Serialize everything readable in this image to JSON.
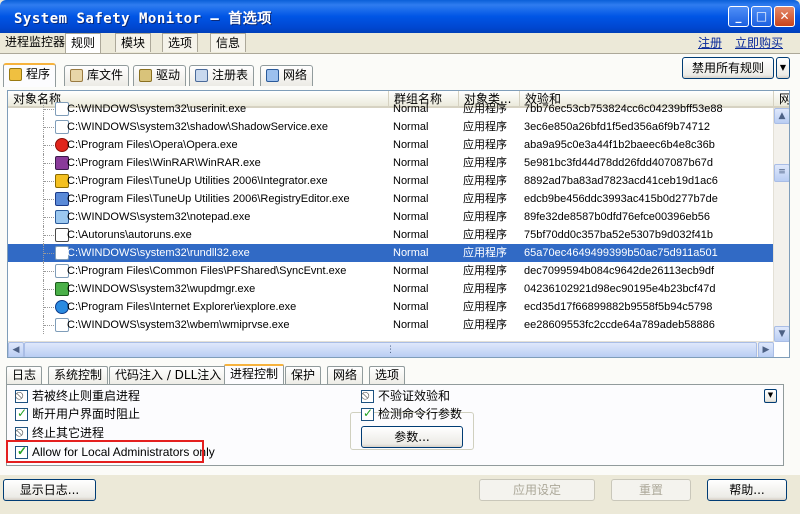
{
  "window": {
    "title": "System Safety Monitor — 首选项"
  },
  "titlebar_buttons": {
    "minimize": "_",
    "maximize": "□",
    "close": "✕"
  },
  "menu_tabs": [
    "进程监控器",
    "规则",
    "模块",
    "选项",
    "信息"
  ],
  "menu_links": {
    "register": "注册",
    "buy": "立即购买"
  },
  "sub_tabs": [
    "程序",
    "库文件",
    "驱动",
    "注册表",
    "网络"
  ],
  "disable_all_button": "禁用所有规则",
  "columns": [
    "对象名称",
    "群组名称",
    "对象类...",
    "效验和",
    "网"
  ],
  "rows": [
    {
      "path": "C:\\WINDOWS\\system32\\userinit.exe",
      "group": "Normal",
      "type": "应用程序",
      "checksum": "7bb76ec53cb753824cc6c04239bff53e88",
      "icon": "file-icon",
      "clip": true
    },
    {
      "path": "C:\\WINDOWS\\system32\\shadow\\ShadowService.exe",
      "group": "Normal",
      "type": "应用程序",
      "checksum": "3ec6e850a26bfd1f5ed356a6f9b74712",
      "icon": "file-icon"
    },
    {
      "path": "C:\\Program Files\\Opera\\Opera.exe",
      "group": "Normal",
      "type": "应用程序",
      "checksum": "aba9a95c0e3a44f1b2baeec6b4e8c36b",
      "icon": "opera-icon"
    },
    {
      "path": "C:\\Program Files\\WinRAR\\WinRAR.exe",
      "group": "Normal",
      "type": "应用程序",
      "checksum": "5e981bc3fd44d78dd26fdd407087b67d",
      "icon": "winrar-icon"
    },
    {
      "path": "C:\\Program Files\\TuneUp Utilities 2006\\Integrator.exe",
      "group": "Normal",
      "type": "应用程序",
      "checksum": "8892ad7ba83ad7823acd41ceb19d1ac6",
      "icon": "tuneup-icon"
    },
    {
      "path": "C:\\Program Files\\TuneUp Utilities 2006\\RegistryEditor.exe",
      "group": "Normal",
      "type": "应用程序",
      "checksum": "edcb9be456ddc3993ac415b0d277b7de",
      "icon": "registry-editor-icon"
    },
    {
      "path": "C:\\WINDOWS\\system32\\notepad.exe",
      "group": "Normal",
      "type": "应用程序",
      "checksum": "89fe32de8587b0dfd76efce00396eb56",
      "icon": "notepad-icon"
    },
    {
      "path": "C:\\Autoruns\\autoruns.exe",
      "group": "Normal",
      "type": "应用程序",
      "checksum": "75bf70dd0c357ba52e5307b9d032f41b",
      "icon": "autoruns-icon"
    },
    {
      "path": "C:\\WINDOWS\\system32\\rundll32.exe",
      "group": "Normal",
      "type": "应用程序",
      "checksum": "65a70ec4649499399b50ac75d911a501",
      "icon": "file-icon",
      "selected": true
    },
    {
      "path": "C:\\Program Files\\Common Files\\PFShared\\SyncEvnt.exe",
      "group": "Normal",
      "type": "应用程序",
      "checksum": "dec7099594b084c9642de26113ecb9df",
      "icon": "file-icon"
    },
    {
      "path": "C:\\WINDOWS\\system32\\wupdmgr.exe",
      "group": "Normal",
      "type": "应用程序",
      "checksum": "04236102921d98ec90195e4b23bcf47d",
      "icon": "windows-update-icon"
    },
    {
      "path": "C:\\Program Files\\Internet Explorer\\iexplore.exe",
      "group": "Normal",
      "type": "应用程序",
      "checksum": "ecd35d17f66899882b9558f5b94c5798",
      "icon": "ie-icon"
    },
    {
      "path": "C:\\WINDOWS\\system32\\wbem\\wmiprvse.exe",
      "group": "Normal",
      "type": "应用程序",
      "checksum": "ee28609553fc2ccde64a789adeb58886",
      "icon": "file-icon"
    }
  ],
  "lower_tabs": [
    "日志",
    "系统控制",
    "代码注入 / DLL注入",
    "进程控制",
    "保护",
    "网络",
    "选项"
  ],
  "options": {
    "restart_if_terminated": "若被终止则重启进程",
    "block_on_ui_disconnect": "断开用户界面时阻止",
    "terminate_other": "终止其它进程",
    "allow_local_admins": "Allow for Local Administrators only",
    "no_checksum": "不验证效验和",
    "check_cmdline": "检测命令行参数",
    "params_button": "参数..."
  },
  "bottom_buttons": {
    "show_log": "显示日志...",
    "apply": "应用设定",
    "reset": "重置",
    "help": "帮助..."
  }
}
